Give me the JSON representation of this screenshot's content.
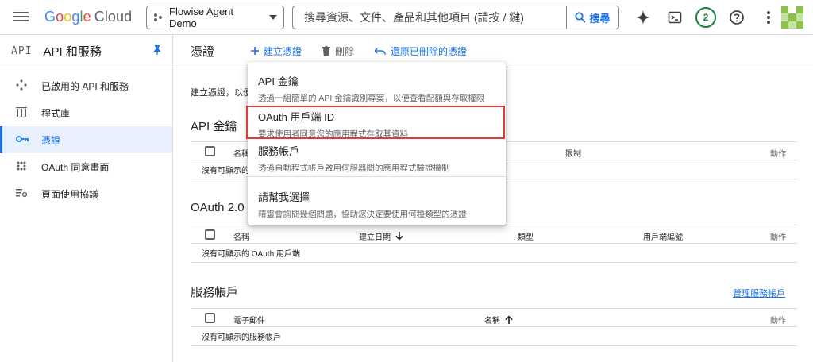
{
  "header": {
    "logo_google": [
      "G",
      "o",
      "o",
      "g",
      "l",
      "e"
    ],
    "logo_cloud": "Cloud",
    "project": "Flowise Agent Demo",
    "search_placeholder": "搜尋資源、文件、產品和其他項目 (請按 / 鍵)",
    "search_button": "搜尋",
    "notifications_count": "2",
    "icons": [
      "gemini-sparkle-icon",
      "cloud-shell-icon",
      "help-icon",
      "more-vert-icon"
    ]
  },
  "sidebar": {
    "api_badge": "API",
    "title": "API 和服務",
    "items": [
      {
        "label": "已啟用的 API 和服務",
        "icon": "enabled-apis-icon"
      },
      {
        "label": "程式庫",
        "icon": "library-icon"
      },
      {
        "label": "憑證",
        "icon": "key-icon",
        "active": true
      },
      {
        "label": "OAuth 同意畫面",
        "icon": "consent-icon"
      },
      {
        "label": "頁面使用協議",
        "icon": "settings-list-icon"
      }
    ]
  },
  "toolbar": {
    "title": "憑證",
    "create": "建立憑證",
    "delete": "刪除",
    "restore": "還原已刪除的憑證"
  },
  "intro": "建立憑證，以便",
  "sections": {
    "api_keys": {
      "title": "API 金鑰",
      "col_name": "名稱",
      "col_restrictions": "限制",
      "col_actions": "動作",
      "empty": "沒有可顯示的"
    },
    "oauth": {
      "title": "OAuth 2.0",
      "col_name": "名稱",
      "col_created": "建立日期",
      "col_type": "類型",
      "col_client_id": "用戶端編號",
      "col_actions": "動作",
      "empty": "沒有可顯示的 OAuth 用戶端"
    },
    "service_accounts": {
      "title": "服務帳戶",
      "manage_link": "管理服務帳戶",
      "col_email": "電子郵件",
      "col_name": "名稱",
      "col_actions": "動作",
      "empty": "沒有可顯示的服務帳戶"
    }
  },
  "menu": {
    "items": [
      {
        "title": "API 金鑰",
        "desc": "透過一組簡單的 API 金鑰識別專案，以便查看配額與存取權限"
      },
      {
        "title": "OAuth 用戶端 ID",
        "desc": "要求使用者同意您的應用程式存取其資料"
      },
      {
        "title": "服務帳戶",
        "desc": "透過自動程式帳戶啟用伺服器間的應用程式驗證機制"
      },
      {
        "title": "請幫我選擇",
        "desc": "精靈會詢問幾個問題，協助您決定要使用何種類型的憑證"
      }
    ]
  },
  "colors": {
    "accent": "#1a73e8",
    "highlight_box": "#e53935"
  }
}
